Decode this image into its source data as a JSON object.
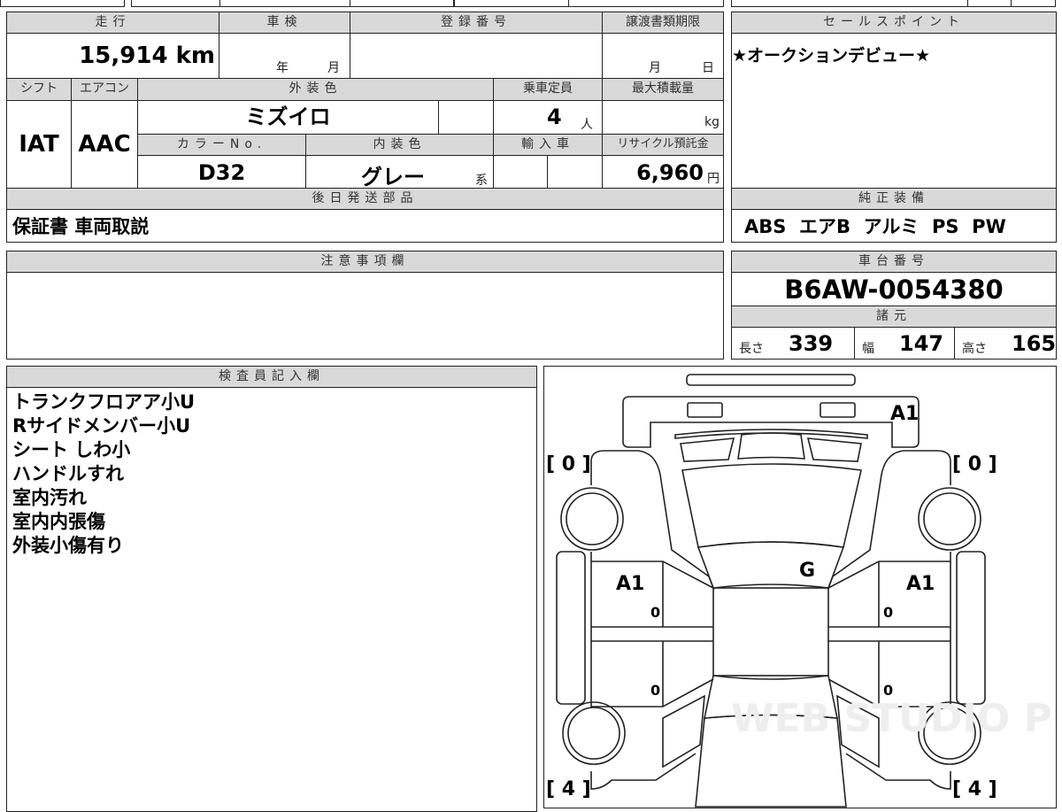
{
  "mileage": {
    "label": "走行",
    "value": "15,914",
    "unit": "km"
  },
  "inspection": {
    "label": "車検",
    "year_unit": "年",
    "month_unit": "月"
  },
  "registration": {
    "label": "登録番号",
    "value": ""
  },
  "transfer_deadline": {
    "label": "譲渡書類期限",
    "month_unit": "月",
    "day_unit": "日"
  },
  "shift": {
    "label": "シフト",
    "value": "IAT"
  },
  "aircon": {
    "label": "エアコン",
    "value": "AAC"
  },
  "exterior_color": {
    "label": "外装色",
    "value": "ミズイロ"
  },
  "capacity": {
    "label": "乗車定員",
    "value": "4",
    "unit": "人"
  },
  "max_load": {
    "label": "最大積載量",
    "unit": "kg"
  },
  "color_no": {
    "label": "カラーNo.",
    "value": "D32"
  },
  "interior_color": {
    "label": "内装色",
    "value": "グレー",
    "suffix": "系"
  },
  "imported": {
    "label": "輸入車"
  },
  "recycle_fee": {
    "label": "リサイクル預託金",
    "value": "6,960",
    "unit": "円"
  },
  "later_parts": {
    "label": "後日発送部品",
    "value": "保証書 車両取説"
  },
  "sales_point": {
    "label": "セールスポイント",
    "value": "★オークションデビュー★"
  },
  "equipment": {
    "label": "純正装備",
    "value": "ABS  エアB  アルミ  PS  PW"
  },
  "caution": {
    "label": "注意事項欄"
  },
  "chassis": {
    "label": "車台番号",
    "value": "B6AW-0054380"
  },
  "specs": {
    "label": "諸元",
    "length_label": "長さ",
    "length": "339",
    "width_label": "幅",
    "width": "147",
    "height_label": "高さ",
    "height": "165"
  },
  "inspector": {
    "label": "検査員記入欄",
    "notes": [
      "トランクフロアア小U",
      "Rサイドメンバー小U",
      "シート しわ小",
      "ハンドルすれ",
      "室内汚れ",
      "室内内張傷",
      "外装小傷有り"
    ]
  },
  "diagram": {
    "rear": "A1",
    "roof": "G",
    "left_door": "A1",
    "right_door": "A1",
    "tire_fl": "[ 0 ]",
    "tire_fr": "[ 0 ]",
    "tire_rl": "[ 4 ]",
    "tire_rr": "[ 4 ]",
    "door_marks": [
      "0",
      "0",
      "0",
      "0"
    ],
    "watermark": "WEB STUDIO PRO"
  }
}
